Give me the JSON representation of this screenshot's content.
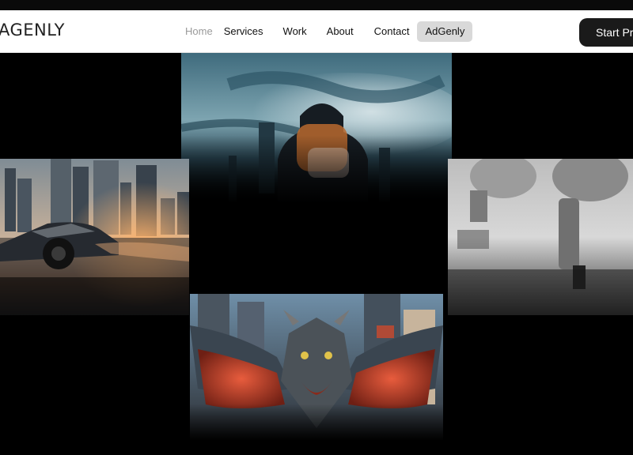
{
  "brand": {
    "logo_text": "AGENLY"
  },
  "nav": {
    "items": [
      {
        "label": "Home",
        "state": "muted"
      },
      {
        "label": "Services",
        "state": "normal"
      },
      {
        "label": "Work",
        "state": "normal"
      },
      {
        "label": "About",
        "state": "normal"
      },
      {
        "label": "Contact",
        "state": "normal"
      },
      {
        "label": "AdGenly",
        "state": "highlighted"
      }
    ]
  },
  "cta": {
    "label": "Start Pr"
  },
  "gallery": {
    "tiles": [
      {
        "id": "hood",
        "subject": "hooded figure against cloudy sky and skyline"
      },
      {
        "id": "car",
        "subject": "futuristic angular car in city at sunset"
      },
      {
        "id": "boots",
        "subject": "legs in puffer boots walking, monochrome"
      },
      {
        "id": "dragon",
        "subject": "dragon with spread red wings over city"
      }
    ]
  },
  "colors": {
    "background": "#000000",
    "navbar": "#ffffff",
    "cta_bg": "#1a1a1a",
    "pill_bg": "#d9d9d9"
  }
}
